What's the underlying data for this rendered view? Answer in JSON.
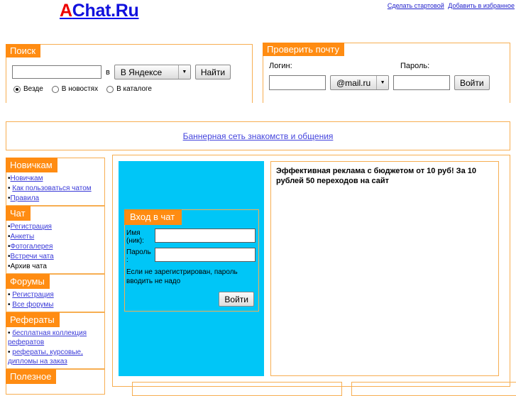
{
  "header": {
    "logo_first": "A",
    "logo_rest": "Chat.Ru",
    "links": [
      {
        "label": "Сделать стартовой"
      },
      {
        "label": "Добавить в избранное"
      }
    ]
  },
  "search": {
    "tab_label": "Поиск",
    "query_value": "",
    "in_label": "в",
    "engine_selected": "В Яндексе",
    "submit_label": "Найти",
    "scope_options": [
      {
        "label": "Везде",
        "selected": true
      },
      {
        "label": "В новостях",
        "selected": false
      },
      {
        "label": "В каталоге",
        "selected": false
      }
    ]
  },
  "mail": {
    "tab_label": "Проверить почту",
    "login_label": "Логин:",
    "password_label": "Пароль:",
    "login_value": "",
    "password_value": "",
    "domain_selected": "@mail.ru",
    "submit_label": "Войти"
  },
  "banner": {
    "link_label": "Баннерная сеть знакомств и общения"
  },
  "sidebar": {
    "blocks": [
      {
        "title": "Новичкам",
        "items": [
          {
            "bullet": "•",
            "label": "Новичкам",
            "link": true
          },
          {
            "bullet": "• ",
            "label": "Как пользоваться чатом",
            "link": true
          },
          {
            "bullet": "•",
            "label": "Правила",
            "link": true
          }
        ]
      },
      {
        "title": "Чат",
        "items": [
          {
            "bullet": "•",
            "label": "Регистрация",
            "link": true
          },
          {
            "bullet": "•",
            "label": "Анкеты",
            "link": true
          },
          {
            "bullet": "•",
            "label": "Фотогалерея",
            "link": true
          },
          {
            "bullet": "•",
            "label": "Встречи чата",
            "link": true
          },
          {
            "bullet": "•",
            "label": "Архив чата",
            "link": false
          }
        ]
      },
      {
        "title": "Форумы",
        "items": [
          {
            "bullet": "• ",
            "label": "Регистрация",
            "link": true
          },
          {
            "bullet": "• ",
            "label": "Все форумы",
            "link": true
          }
        ]
      },
      {
        "title": "Рефераты",
        "items": [
          {
            "bullet": "• ",
            "label": "бесплатная коллекция рефератов",
            "link": true
          },
          {
            "bullet": "• ",
            "label": "рефераты, курсовые, дипломы на заказ",
            "link": true
          }
        ]
      },
      {
        "title": "Полезное",
        "items": []
      }
    ]
  },
  "chat_login": {
    "tab_label": "Вход в чат",
    "name_label": "Имя (ник):",
    "password_label": "Пароль :",
    "name_value": "",
    "password_value": "",
    "note": "Если не зарегистрирован, пароль вводить не надо",
    "submit_label": "Войти"
  },
  "ad": {
    "text": "Эффективная реклама с бюджетом от 10 руб! За 10 рублей 50 переходов на сайт"
  },
  "colors": {
    "accent_orange": "#ff8c12",
    "border_orange": "#f7ae52",
    "chat_cyan": "#00c6f7",
    "link_blue": "#3a3ad8",
    "logo_red": "#ee0000"
  }
}
